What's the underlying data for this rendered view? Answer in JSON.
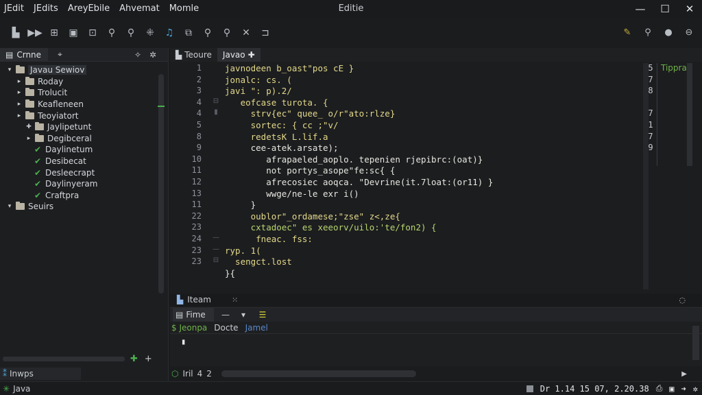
{
  "window": {
    "menu": [
      "JEdit",
      "JEdits",
      "AreyEbile",
      "Ahvemat",
      "Momle"
    ],
    "title": "Editie",
    "controls": [
      "—",
      "☐",
      "✕"
    ]
  },
  "toolbar": {
    "icons": [
      "new-file-icon",
      "run-icon",
      "layout-icon",
      "save-icon",
      "build-icon",
      "search-icon",
      "find-icon",
      "debug-icon",
      "music-icon",
      "copy-icon",
      "search-icon",
      "zoom-icon",
      "cut-icon",
      "export-icon"
    ],
    "right_icons": [
      "pen-icon",
      "search-icon",
      "badge-icon",
      "settings-icon"
    ]
  },
  "left_panel": {
    "tab_label": "Crnne",
    "tree": [
      {
        "indent": 0,
        "twisty": "▾",
        "kind": "folder",
        "label": "Javau Sewiov",
        "selected": true
      },
      {
        "indent": 1,
        "twisty": "▸",
        "kind": "folder",
        "label": "Roday"
      },
      {
        "indent": 1,
        "twisty": "▸",
        "kind": "folder",
        "label": "Trolucit"
      },
      {
        "indent": 1,
        "twisty": "▸",
        "kind": "folder",
        "label": "Keafleneen"
      },
      {
        "indent": 1,
        "twisty": "▸",
        "kind": "folder",
        "label": "Teoyiatort"
      },
      {
        "indent": 2,
        "twisty": "✚",
        "kind": "folder",
        "label": "Jaylipetunt"
      },
      {
        "indent": 2,
        "twisty": "▸",
        "kind": "folder",
        "label": "Degibceral"
      },
      {
        "indent": 2,
        "twisty": "",
        "kind": "check",
        "label": "Daylinetum"
      },
      {
        "indent": 2,
        "twisty": "",
        "kind": "check",
        "label": "Desibecat"
      },
      {
        "indent": 2,
        "twisty": "",
        "kind": "check",
        "label": "Desleecrapt"
      },
      {
        "indent": 2,
        "twisty": "",
        "kind": "check",
        "label": "Daylinyeram"
      },
      {
        "indent": 2,
        "twisty": "",
        "kind": "check",
        "label": "Craftpra"
      },
      {
        "indent": 0,
        "twisty": "▾",
        "kind": "folder",
        "label": "Seuirs"
      }
    ],
    "footer_label": "Inwps"
  },
  "editor": {
    "tabs": [
      {
        "label": "Teoure",
        "active": false
      },
      {
        "label": "Javao",
        "active": true
      }
    ],
    "line_numbers": [
      "1",
      "2",
      "3",
      "4",
      "4",
      "5",
      "8",
      "9",
      "10",
      "11",
      "12",
      "13",
      "11",
      "22",
      "23",
      "24",
      "23",
      "23"
    ],
    "lines": [
      {
        "text": "javnodeen b_oast\"pos cE }",
        "c": "y"
      },
      {
        "text": "jonalc: cs. (",
        "c": "y"
      },
      {
        "text": "javi \": p).2/",
        "c": "y"
      },
      {
        "text": "   eofcase turota. {",
        "c": "y"
      },
      {
        "text": "     strv{ec\" quee_ o/r\"ato:rlze}",
        "c": "y"
      },
      {
        "text": "     sortec: { cc ;\"v/",
        "c": "y"
      },
      {
        "text": "     redetsK L.lif.a",
        "c": "y"
      },
      {
        "text": "     cee-atek.arsate);",
        "c": "w"
      },
      {
        "text": "        afrapaeled_aoplo. tepenien rjepibrc:(oat)}",
        "c": "w"
      },
      {
        "text": "        not portys_asope\"fe:sc{ {",
        "c": "w"
      },
      {
        "text": "        afrecosiec aoqca. \"Devrine(it.7loat:(or11) }",
        "c": "w"
      },
      {
        "text": "        wwge/ne-le exr i()",
        "c": "w"
      },
      {
        "text": "     }",
        "c": "w"
      },
      {
        "text": "     oublor\"_ordamese;\"zse\" z<,ze{",
        "c": "y"
      },
      {
        "text": "     cxtadoec\" es xeeorv/uilo:'te/fon2) {",
        "c": "g"
      },
      {
        "text": "      fneac. fss:",
        "c": "y"
      },
      {
        "text": "ryp. 1(",
        "c": "y"
      },
      {
        "text": "  sengct.lost",
        "c": "y"
      },
      {
        "text": "}{",
        "c": "w"
      }
    ],
    "gutter_marks": [
      "",
      "",
      "",
      "⊟",
      "▮",
      "",
      "",
      "",
      "",
      "",
      "",
      "",
      "",
      "",
      "",
      "—",
      "—",
      "⊟"
    ],
    "side_numbers": [
      "5",
      "7",
      "8",
      "",
      "7",
      "1",
      "7",
      "9"
    ],
    "side_label": "Tippra"
  },
  "sub_bar": {
    "tab_label": "Iteam",
    "right_icon": "expand-icon"
  },
  "bottom_panel": {
    "tab_label": "Fime",
    "row": [
      "$ Jeonpa",
      "Docte",
      "Jamel"
    ],
    "content": "▮"
  },
  "hscroll": {
    "label": "Iril",
    "nums": [
      "4",
      "2"
    ]
  },
  "status": {
    "left_label": "Java",
    "right_text": "Dr 1.14 15 07, 2.20.38"
  }
}
